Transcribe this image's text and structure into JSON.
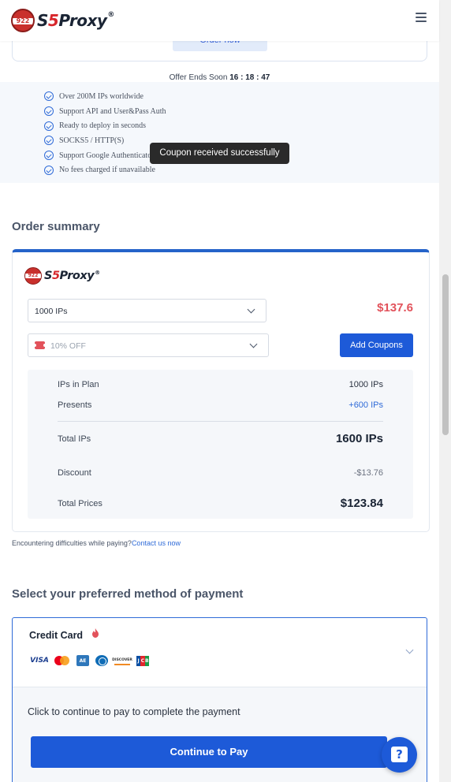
{
  "brand": {
    "logo_badge": "922",
    "name_prefix": "S",
    "name_five": "5",
    "name_suffix": "Proxy",
    "reg": "®"
  },
  "header": {
    "menu_icon": "hamburger-icon"
  },
  "top": {
    "order_now_label": "Order now",
    "offer_label": "Offer Ends Soon",
    "countdown": "16 : 18 : 47",
    "features": [
      "Over 200M IPs worldwide",
      "Support API and User&Pass Auth",
      "Ready to deploy in seconds",
      "SOCKS5 / HTTP(S)",
      "Support Google Authenticator",
      "No fees charged if unavailable"
    ],
    "toast": "Coupon received successfully"
  },
  "summary": {
    "title": "Order summary",
    "plan_select": "1000 IPs",
    "price": "$137.6",
    "coupon_select": "10% OFF",
    "add_coupons_label": "Add Coupons",
    "rows": {
      "ips_in_plan": {
        "label": "IPs in Plan",
        "value": "1000 IPs"
      },
      "presents": {
        "label": "Presents",
        "value": "+600 IPs"
      },
      "total_ips": {
        "label": "Total IPs",
        "value": "1600 IPs"
      },
      "discount": {
        "label": "Discount",
        "value": "-$13.76"
      },
      "total_prices": {
        "label": "Total Prices",
        "value": "$123.84"
      }
    },
    "help_text": "Encountering difficulties while paying?",
    "help_link": "Contact us now"
  },
  "payment": {
    "title": "Select your preferred method of payment",
    "method": "Credit Card",
    "card_brands": [
      "VISA",
      "mastercard",
      "AMEX",
      "Diners",
      "DISCOVER",
      "JCB"
    ],
    "instruction": "Click to continue to pay to complete the payment",
    "continue_label": "Continue to Pay",
    "help_fab_glyph": "?"
  },
  "colors": {
    "accent": "#1d5ad8",
    "price_red": "#e2525b",
    "brand_red": "#d7262b"
  }
}
